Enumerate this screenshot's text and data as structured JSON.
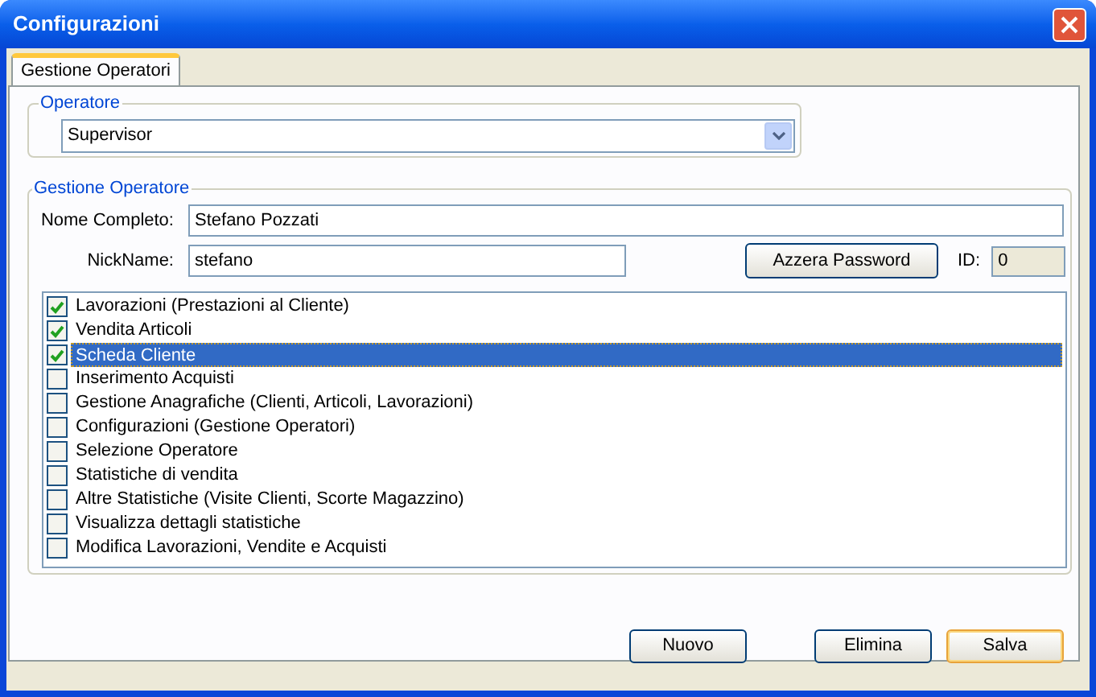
{
  "window": {
    "title": "Configurazioni"
  },
  "tabs": [
    {
      "label": "Gestione Operatori",
      "selected": true
    }
  ],
  "operatore": {
    "legend": "Operatore",
    "value": "Supervisor"
  },
  "gestione": {
    "legend": "Gestione Operatore",
    "nome_label": "Nome Completo:",
    "nome_value": "Stefano Pozzati",
    "nick_label": "NickName:",
    "nick_value": "stefano",
    "reset_button": "Azzera Password",
    "id_label": "ID:",
    "id_value": "0",
    "permissions": [
      {
        "label": "Lavorazioni (Prestazioni al Cliente)",
        "checked": true,
        "selected": false
      },
      {
        "label": "Vendita Articoli",
        "checked": true,
        "selected": false
      },
      {
        "label": "Scheda Cliente",
        "checked": true,
        "selected": true
      },
      {
        "label": "Inserimento Acquisti",
        "checked": false,
        "selected": false
      },
      {
        "label": "Gestione Anagrafiche (Clienti, Articoli, Lavorazioni)",
        "checked": false,
        "selected": false
      },
      {
        "label": "Configurazioni (Gestione Operatori)",
        "checked": false,
        "selected": false
      },
      {
        "label": "Selezione Operatore",
        "checked": false,
        "selected": false
      },
      {
        "label": "Statistiche di vendita",
        "checked": false,
        "selected": false
      },
      {
        "label": "Altre Statistiche (Visite Clienti, Scorte Magazzino)",
        "checked": false,
        "selected": false
      },
      {
        "label": "Visualizza dettagli statistiche",
        "checked": false,
        "selected": false
      },
      {
        "label": "Modifica Lavorazioni, Vendite e Acquisti",
        "checked": false,
        "selected": false
      }
    ]
  },
  "buttons": [
    {
      "label": "Nuovo",
      "default": false
    },
    {
      "label": "Elimina",
      "default": false
    },
    {
      "label": "Salva",
      "default": true
    }
  ]
}
